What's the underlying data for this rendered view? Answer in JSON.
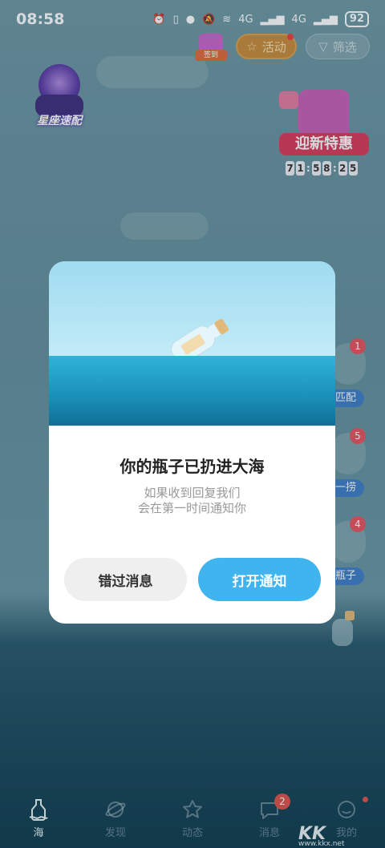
{
  "status_bar": {
    "time": "08:58",
    "network_1": "4G",
    "network_2": "4G",
    "battery": "92"
  },
  "top_bar": {
    "checkin_label": "签到",
    "activity_label": "活动",
    "filter_label": "筛选"
  },
  "constellation": {
    "label": "星座速配"
  },
  "new_user_deal": {
    "label": "迎新特惠",
    "timer_digits": [
      "7",
      "1",
      "5",
      "8",
      "2",
      "5"
    ]
  },
  "side_buttons": [
    {
      "label": "匹配",
      "badge": "1"
    },
    {
      "label": "一捞",
      "badge": "5"
    },
    {
      "label": "瓶子",
      "badge": "4"
    }
  ],
  "modal": {
    "title": "你的瓶子已扔进大海",
    "subtitle_line1": "如果收到回复我们",
    "subtitle_line2": "会在第一时间通知你",
    "miss_button": "错过消息",
    "open_button": "打开通知"
  },
  "bottom_nav": {
    "items": [
      {
        "label": "海",
        "icon": "bottle-icon",
        "active": true
      },
      {
        "label": "发现",
        "icon": "planet-icon"
      },
      {
        "label": "动态",
        "icon": "star-icon"
      },
      {
        "label": "消息",
        "icon": "chat-icon",
        "badge": "2"
      },
      {
        "label": "我的",
        "icon": "face-icon"
      }
    ]
  },
  "watermark": {
    "logo": "KK",
    "url": "www.kkx.net"
  },
  "colors": {
    "accent": "#3fb4ef",
    "badge_red": "#e05048",
    "sea": "#1a8fb8"
  }
}
